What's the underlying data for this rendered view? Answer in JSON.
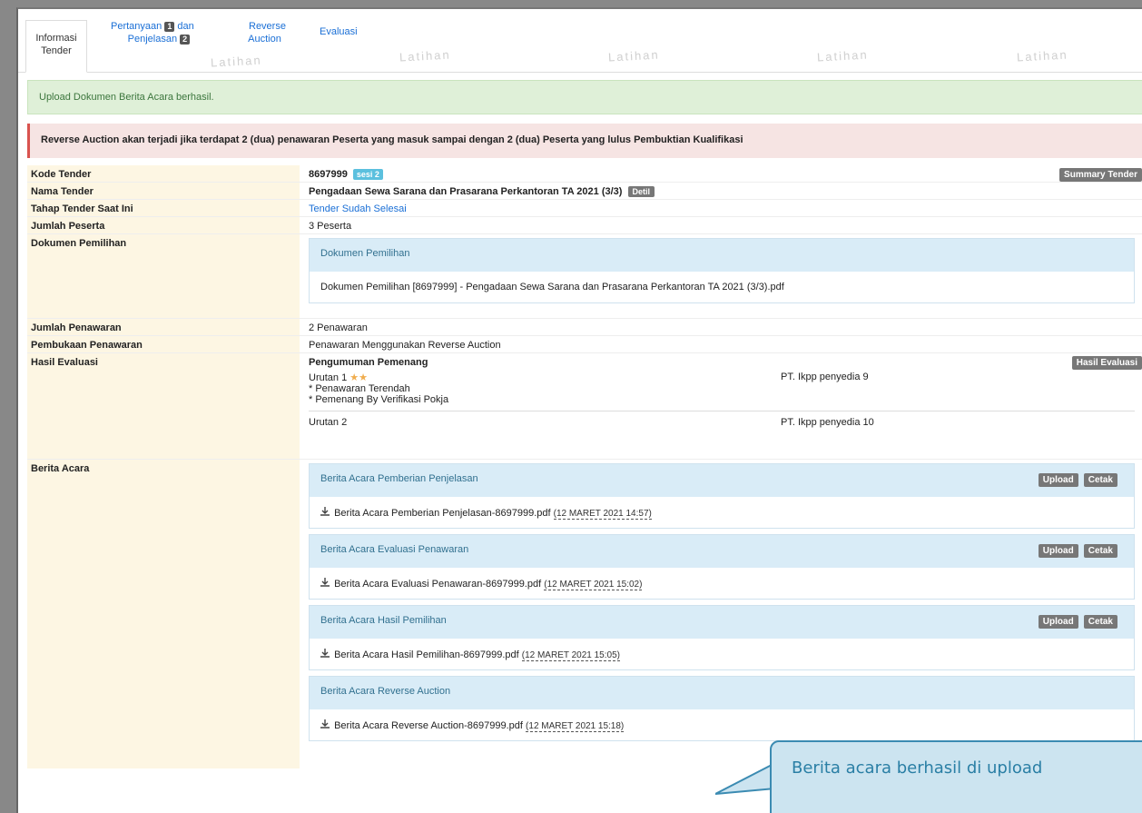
{
  "tabs": {
    "informasi_line1": "Informasi",
    "informasi_line2": "Tender",
    "pertanyaan_line1_a": "Pertanyaan",
    "pertanyaan_badge1": "1",
    "pertanyaan_line1_b": "dan",
    "pertanyaan_line2": "Penjelasan",
    "pertanyaan_badge2": "2",
    "reverse_line1": "Reverse",
    "reverse_line2": "Auction",
    "evaluasi": "Evaluasi"
  },
  "watermark": "Latihan",
  "alerts": {
    "success": "Upload Dokumen Berita Acara berhasil.",
    "warning": "Reverse Auction akan terjadi jika terdapat 2 (dua) penawaran Peserta yang masuk sampai dengan 2 (dua) Peserta yang lulus Pembuktian Kualifikasi"
  },
  "rows": {
    "kode_label": "Kode Tender",
    "kode_value": "8697999",
    "kode_tag": "sesi 2",
    "summary_btn": "Summary Tender",
    "nama_label": "Nama Tender",
    "nama_value": "Pengadaan Sewa Sarana dan Prasarana Perkantoran TA 2021 (3/3)",
    "nama_tag": "Detil",
    "tahap_label": "Tahap Tender Saat Ini",
    "tahap_value": "Tender Sudah Selesai",
    "jumlah_peserta_label": "Jumlah Peserta",
    "jumlah_peserta_value": "3 Peserta",
    "dokumen_label": "Dokumen Pemilihan",
    "dokumen_panel_title": "Dokumen Pemilihan",
    "dokumen_panel_file": "Dokumen Pemilihan [8697999] - Pengadaan Sewa Sarana dan Prasarana Perkantoran TA 2021 (3/3).pdf",
    "jumlah_penawaran_label": "Jumlah Penawaran",
    "jumlah_penawaran_value": "2 Penawaran",
    "pembukaan_label": "Pembukaan Penawaran",
    "pembukaan_value": "Penawaran Menggunakan Reverse Auction",
    "hasil_label": "Hasil Evaluasi",
    "hasil_title": "Pengumuman Pemenang",
    "hasil_btn": "Hasil Evaluasi",
    "urutan1": "Urutan 1",
    "urutan1_stars": "★★",
    "urutan1_peserta": "PT. Ikpp penyedia 9",
    "urutan1_note1": "* Penawaran Terendah",
    "urutan1_note2": "* Pemenang By Verifikasi Pokja",
    "urutan2": "Urutan 2",
    "urutan2_peserta": "PT. Ikpp penyedia 10",
    "berita_label": "Berita Acara"
  },
  "berita_acara": [
    {
      "title": "Berita Acara Pemberian Penjelasan",
      "file": "Berita Acara Pemberian Penjelasan-8697999.pdf",
      "date": "(12 MARET 2021 14:57)",
      "upload": "Upload",
      "cetak": "Cetak"
    },
    {
      "title": "Berita Acara Evaluasi Penawaran",
      "file": "Berita Acara Evaluasi Penawaran-8697999.pdf",
      "date": "(12 MARET 2021 15:02)",
      "upload": "Upload",
      "cetak": "Cetak"
    },
    {
      "title": "Berita Acara Hasil Pemilihan",
      "file": "Berita Acara Hasil Pemilihan-8697999.pdf",
      "date": "(12 MARET 2021 15:05)",
      "upload": "Upload",
      "cetak": "Cetak"
    },
    {
      "title": "Berita Acara Reverse Auction",
      "file": "Berita Acara Reverse Auction-8697999.pdf",
      "date": "(12 MARET 2021 15:18)"
    }
  ],
  "callout": "Berita acara berhasil di upload",
  "colors": {
    "success_bg": "#dff0d8",
    "danger_bg": "#f6e4e3",
    "label_bg": "#fdf6e3",
    "panel_header_bg": "#d9ecf7",
    "link": "#1a6fd6",
    "callout_bg": "#cce4f0"
  },
  "icons": {
    "download": "download-icon"
  }
}
